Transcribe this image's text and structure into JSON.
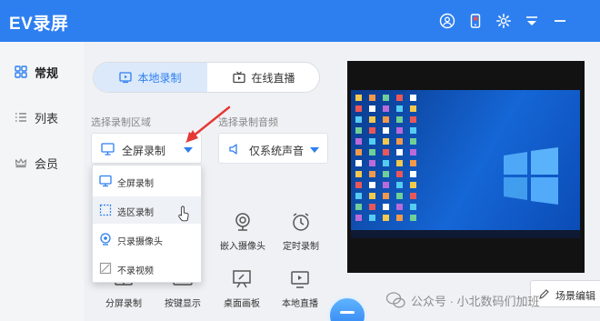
{
  "app": {
    "title": "EV录屏"
  },
  "titlebar": {
    "icons": [
      "user-icon",
      "phone-icon",
      "settings-icon",
      "minimize-to-tray-icon",
      "minimize-icon"
    ]
  },
  "sidebar": {
    "items": [
      {
        "label": "常规",
        "icon": "grid-icon",
        "active": true
      },
      {
        "label": "列表",
        "icon": "list-icon",
        "active": false
      },
      {
        "label": "会员",
        "icon": "crown-icon",
        "active": false
      }
    ]
  },
  "modes": {
    "local": "本地录制",
    "live": "在线直播"
  },
  "area": {
    "label": "选择录制区域",
    "value": "全屏录制"
  },
  "audio": {
    "label": "选择录制音频",
    "value": "仅系统声音"
  },
  "area_menu": {
    "items": [
      {
        "label": "全屏录制",
        "icon": "monitor-icon"
      },
      {
        "label": "选区录制",
        "icon": "selection-icon"
      },
      {
        "label": "只录摄像头",
        "icon": "webcam-icon"
      },
      {
        "label": "不录视频",
        "icon": "no-video-icon"
      }
    ],
    "hover_index": 1
  },
  "tools": {
    "embed_camera": "嵌入摄像头",
    "timer": "定时录制",
    "split": "分屏录制",
    "keys": "按键显示",
    "whiteboard": "桌面画板",
    "local_live": "本地直播"
  },
  "scene_edit": {
    "label": "场景编辑"
  },
  "watermark": {
    "text": "公众号 · 小北数码们加班"
  },
  "colors": {
    "accent": "#2d7ff0",
    "annotation_arrow": "#e53935"
  }
}
